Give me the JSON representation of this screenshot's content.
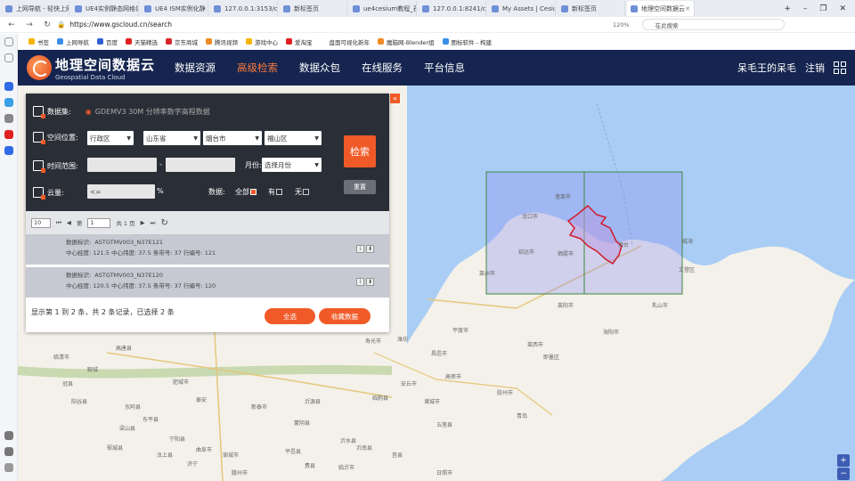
{
  "browser": {
    "tabs": [
      {
        "title": "上网导航 - 轻快上网"
      },
      {
        "title": "UE4实例静态网格体"
      },
      {
        "title": "UE4 ISM实例化静"
      },
      {
        "title": "127.0.0.1:3153/ce"
      },
      {
        "title": "新标签页"
      },
      {
        "title": "ue4cesium教程_石"
      },
      {
        "title": "127.0.0.1:8241/ce"
      },
      {
        "title": "My Assets | Cesiu"
      },
      {
        "title": "新标签页"
      },
      {
        "title": "地理空间数据云"
      }
    ],
    "url": "https://www.gscloud.cn/search",
    "zoom": "120%",
    "search_placeholder": "在此搜索",
    "bookmarks": [
      "书签",
      "上网导航",
      "百度",
      "天猫精选",
      "京东商城",
      "腾讯视频",
      "游戏中心",
      "爱淘宝",
      "盘面可视化新年",
      "魔脑网-Blender组",
      "图标软件 - 构建"
    ]
  },
  "site": {
    "logo_cn": "地理空间数据云",
    "logo_en": "Geospatial Data Cloud",
    "menu": [
      "数据资源",
      "高级检索",
      "数据众包",
      "在线服务",
      "平台信息"
    ],
    "active_menu": "高级检索",
    "username": "呆毛王的呆毛",
    "logout": "注销"
  },
  "panel": {
    "dataset_label": "数据集:",
    "dataset_value": "GDEMV3 30M 分辨率数字高程数据",
    "location_label": "空间位置:",
    "location_type": "行政区",
    "province": "山东省",
    "city": "烟台市",
    "district": "福山区",
    "time_label": "时间范围:",
    "month_label": "月份:",
    "month_placeholder": "选择月份",
    "cloud_label": "云量:",
    "cloud_value": "<=",
    "cloud_unit": "%",
    "data_label": "数据:",
    "data_all": "全部",
    "data_yes": "有",
    "data_no": "无",
    "search_button": "检索",
    "reset_button": "重置",
    "pager": {
      "page_size": "10",
      "page_prefix": "第",
      "page": "1",
      "page_total": "共 1 页"
    },
    "records": [
      {
        "id_label": "数据标识:",
        "id": "ASTGTMV003_N37E121",
        "center_label": "中心经度:",
        "lon": "121.5",
        "lat_label": "中心纬度:",
        "lat": "37.5",
        "band_label": "条带号:",
        "band": "37",
        "row_label": "行编号:",
        "row": "121"
      },
      {
        "id_label": "数据标识:",
        "id": "ASTGTMV003_N37E120",
        "center_label": "中心经度:",
        "lon": "120.5",
        "lat_label": "中心纬度:",
        "lat": "37.5",
        "band_label": "条带号:",
        "band": "37",
        "row_label": "行编号:",
        "row": "120"
      }
    ],
    "summary": "显示第 1 到 2 条，共 2 条记录，已选择 2 条",
    "select_all": "全选",
    "favorite": "收藏数据"
  },
  "map": {
    "labels": [
      "烟台",
      "威海",
      "龙口市",
      "蓬莱市",
      "招远市",
      "栖霞市",
      "莱阳市",
      "海阳市",
      "乳山市",
      "文登区",
      "青岛",
      "潍坊",
      "聊城",
      "泰安",
      "济宁",
      "日照市",
      "临沂市",
      "莒县",
      "沂水县",
      "平度市",
      "即墨区",
      "高密市",
      "诸城市",
      "五莲县",
      "蒙阴县",
      "新泰市",
      "肥城市",
      "梁山县",
      "郓城县",
      "东平县",
      "滕州市",
      "曲阜市",
      "邹城市",
      "平邑县",
      "费县",
      "沂南县",
      "莱州市",
      "莱西市",
      "胶州市",
      "安丘市",
      "昌邑市",
      "寿光市",
      "临朐县",
      "沂源县",
      "宁阳县",
      "汶上县",
      "临清市",
      "冠县",
      "阳谷县",
      "高唐县",
      "东阿县"
    ]
  },
  "colors": {
    "accent": "#f05a28",
    "header": "#15254f",
    "sea": "#a9cdf5",
    "panel_dark": "#2a2e36"
  }
}
